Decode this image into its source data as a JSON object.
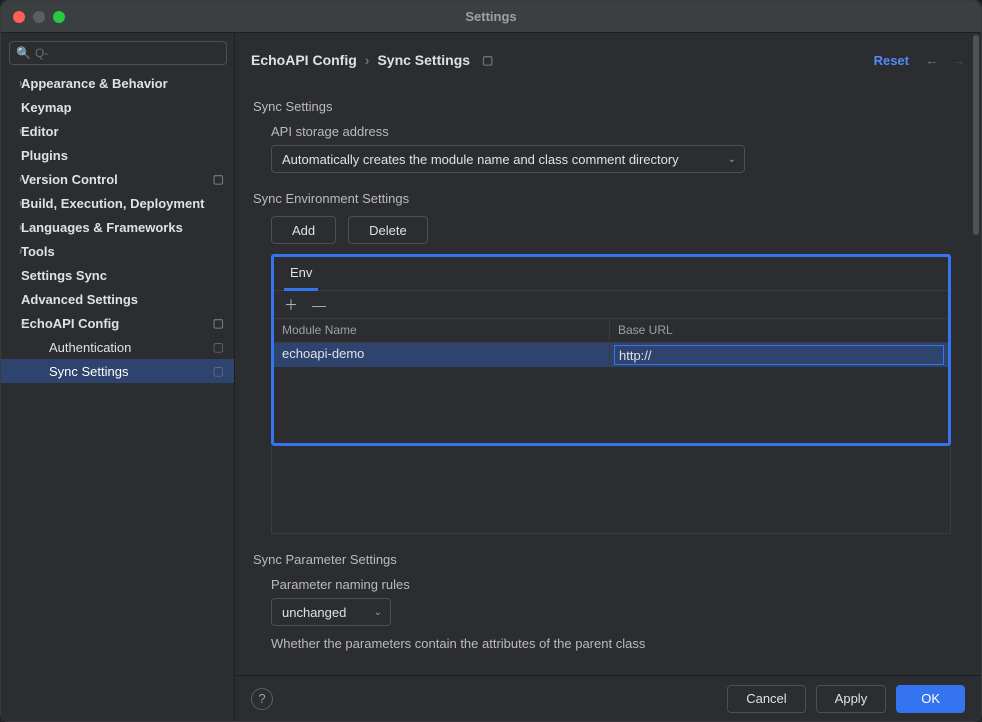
{
  "window_title": "Settings",
  "search_placeholder": "Q-",
  "sidebar": {
    "items": [
      {
        "label": "Appearance & Behavior",
        "expandable": true
      },
      {
        "label": "Keymap",
        "expandable": false
      },
      {
        "label": "Editor",
        "expandable": true
      },
      {
        "label": "Plugins",
        "expandable": false
      },
      {
        "label": "Version Control",
        "expandable": true,
        "gear": true
      },
      {
        "label": "Build, Execution, Deployment",
        "expandable": true
      },
      {
        "label": "Languages & Frameworks",
        "expandable": true
      },
      {
        "label": "Tools",
        "expandable": true
      },
      {
        "label": "Settings Sync",
        "expandable": false
      },
      {
        "label": "Advanced Settings",
        "expandable": false
      },
      {
        "label": "EchoAPI Config",
        "expandable": true,
        "expanded": true,
        "gear": true
      }
    ],
    "children": {
      "auth": "Authentication",
      "sync": "Sync Settings"
    }
  },
  "breadcrumb": {
    "part1": "EchoAPI Config",
    "part2": "Sync Settings"
  },
  "reset_label": "Reset",
  "sections": {
    "sync_settings": "Sync Settings",
    "api_storage": "API storage address",
    "api_storage_value": "Automatically creates the module name and class comment directory",
    "sync_env": "Sync Environment Settings",
    "add": "Add",
    "delete": "Delete",
    "env_tab": "Env",
    "col_module": "Module Name",
    "col_base": "Base URL",
    "row_module": "echoapi-demo",
    "row_base": "http://",
    "sync_param": "Sync Parameter Settings",
    "naming_rules": "Parameter naming rules",
    "naming_value": "unchanged",
    "parent_class": "Whether the parameters contain the attributes of the parent class"
  },
  "footer": {
    "cancel": "Cancel",
    "apply": "Apply",
    "ok": "OK"
  }
}
